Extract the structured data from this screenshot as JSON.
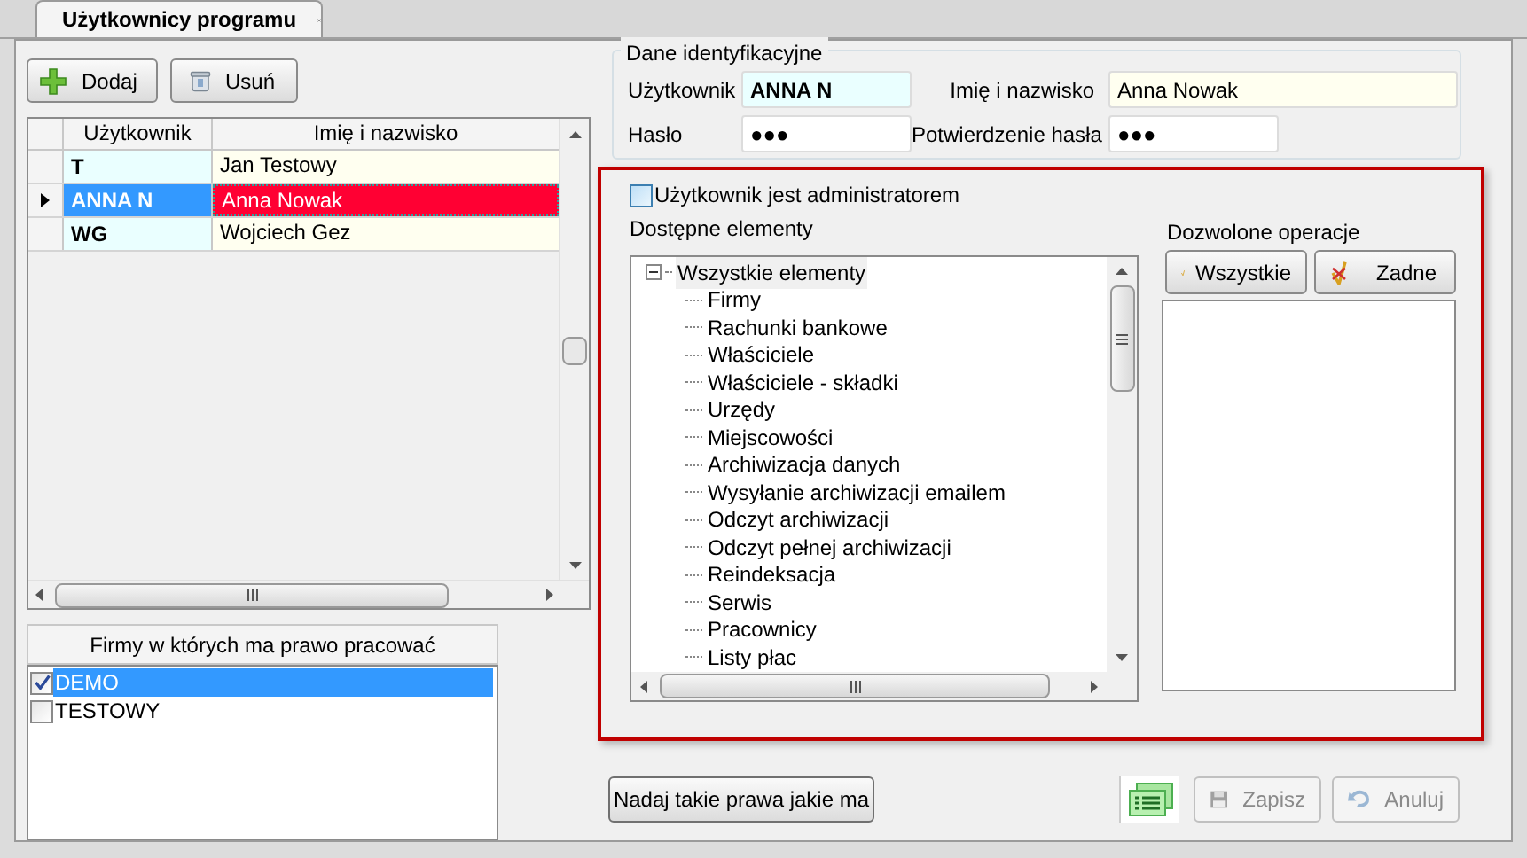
{
  "tab": {
    "title": "Użytkownicy programu",
    "selected": true
  },
  "toolbar": [
    {
      "label": "Dodaj",
      "kind": "add"
    },
    {
      "label": "Usuń",
      "kind": "delete"
    }
  ],
  "users_table": {
    "columns": [
      "Użytkownik",
      "Imię i nazwisko"
    ],
    "rows": [
      {
        "login": "T",
        "name": "Jan Testowy",
        "selected": false
      },
      {
        "login": "ANNA N",
        "name": "Anna Nowak",
        "selected": true
      },
      {
        "login": "WG",
        "name": "Wojciech Gez",
        "selected": false
      }
    ]
  },
  "firms": {
    "title": "Firmy w których ma prawo pracować",
    "items": [
      {
        "label": "DEMO",
        "checked": true,
        "selected": true
      },
      {
        "label": "TESTOWY",
        "checked": false,
        "selected": false
      }
    ]
  },
  "identity": {
    "title": "Dane identyfikacyjne",
    "fields": [
      {
        "label": "Użytkownik",
        "value": "ANNA N",
        "kind": "login"
      },
      {
        "label": "Imię i nazwisko",
        "value": "Anna Nowak",
        "kind": "name"
      },
      {
        "label": "Hasło",
        "value": "●●●",
        "kind": "password"
      },
      {
        "label": "Potwierdzenie hasła",
        "value": "●●●",
        "kind": "password"
      }
    ]
  },
  "admin_checkbox": {
    "label": "Użytkownik jest administratorem",
    "checked": false
  },
  "available": {
    "title": "Dostępne elementy",
    "tree": [
      {
        "label": "Wszystkie elementy",
        "expanded": true,
        "selected": true,
        "children": [
          {
            "label": "Firmy",
            "selected": false
          },
          {
            "label": "Rachunki bankowe",
            "selected": false
          },
          {
            "label": "Właściciele",
            "selected": false
          },
          {
            "label": "Właściciele - składki",
            "selected": false
          },
          {
            "label": "Urzędy",
            "selected": false
          },
          {
            "label": "Miejscowości",
            "selected": false
          },
          {
            "label": "Archiwizacja danych",
            "selected": false
          },
          {
            "label": "Wysyłanie archiwizacji emailem",
            "selected": false
          },
          {
            "label": "Odczyt archiwizacji",
            "selected": false
          },
          {
            "label": "Odczyt pełnej archiwizacji",
            "selected": false
          },
          {
            "label": "Reindeksacja",
            "selected": false
          },
          {
            "label": "Serwis",
            "selected": false
          },
          {
            "label": "Pracownicy",
            "selected": false
          },
          {
            "label": "Listy płac",
            "selected": false
          }
        ]
      }
    ]
  },
  "allowed": {
    "title": "Dozwolone operacje",
    "buttons": [
      {
        "label": "Wszystkie",
        "kind": "all"
      },
      {
        "label": "Zadne",
        "kind": "none"
      }
    ]
  },
  "copy_button": {
    "label": "Nadaj takie prawa jakie ma"
  },
  "actions": [
    {
      "label": "Zapisz",
      "kind": "save",
      "disabled": true
    },
    {
      "label": "Anuluj",
      "kind": "cancel",
      "disabled": true
    }
  ]
}
